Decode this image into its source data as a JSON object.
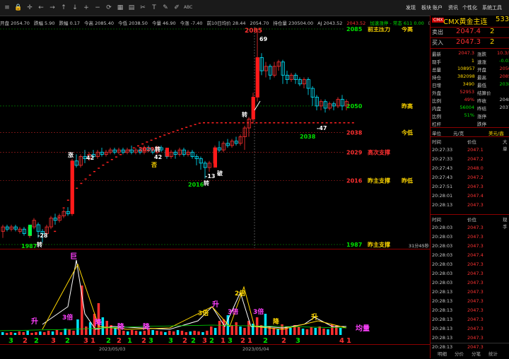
{
  "toolbar": {
    "icons": [
      "menu-icon",
      "lock-icon",
      "crosshair-icon",
      "back-icon",
      "forward-icon",
      "up-icon",
      "down-icon",
      "zoom-in-icon",
      "zoom-out-icon",
      "refresh-icon",
      "chart-icon",
      "grid-icon",
      "cut-icon",
      "text-icon",
      "draw-icon",
      "pen-icon",
      "abc-icon"
    ],
    "abc_label": "ABC",
    "menu": [
      "发现",
      "板块",
      "账户",
      "资讯",
      "个性化",
      "系统工具"
    ]
  },
  "infostrip": [
    {
      "label": "开盘 2054.70",
      "color": "#c8c8c8"
    },
    {
      "label": "跌幅 5.90",
      "color": "#c8c8c8"
    },
    {
      "label": "跌幅 0.17",
      "color": "#c8c8c8"
    },
    {
      "label": "今高 2085.40",
      "color": "#c8c8c8"
    },
    {
      "label": "今低 2038.50",
      "color": "#c8c8c8"
    },
    {
      "label": "今量 46.90",
      "color": "#c8c8c8"
    },
    {
      "label": "今涨 -7.40",
      "color": "#c8c8c8"
    },
    {
      "label": "前10日均价 28.44",
      "color": "#c8c8c8"
    },
    {
      "label": "2054.70",
      "color": "#c8c8c8"
    },
    {
      "label": "持仓量 230504.00",
      "color": "#c8c8c8"
    },
    {
      "label": "AJ 2043.52",
      "color": "#c8c8c8"
    },
    {
      "label": "2043.52",
      "color": "#ff3030"
    },
    {
      "label": "加速涨停 - 常态 611 0.00",
      "color": "#00e000"
    },
    {
      "label": "Delay",
      "color": "#888"
    }
  ],
  "levels": [
    {
      "value": "2085",
      "text": "前主压力",
      "text2": "今高",
      "color": "#00e000",
      "textcolor": "#ffd700"
    },
    {
      "value": "2050",
      "text": "",
      "text2": "昨高",
      "color": "#00e000",
      "textcolor": "#ffd700"
    },
    {
      "value": "2038",
      "text": "",
      "text2": "今低",
      "color": "#ff3030",
      "textcolor": "#ffd700"
    },
    {
      "value": "2029",
      "text": "高次支撑",
      "text2": "",
      "color": "#ff3030",
      "textcolor": "#ff3030"
    },
    {
      "value": "2016",
      "text": "昨主支撑",
      "text2": "昨低",
      "color": "#ff3030",
      "textcolor": "#ffd700"
    },
    {
      "value": "1987",
      "text": "昨主支撑",
      "text2": "",
      "color": "#00e000",
      "textcolor": "#ffd700"
    }
  ],
  "chart_labels": {
    "peak": "2085",
    "peak_num": "69",
    "n42": "42",
    "n2029": "2029",
    "zhuan": "转",
    "n42b": "42",
    "fou": "否",
    "n13": "-13",
    "po": "破",
    "n2016": "2016",
    "n2016z": "转",
    "n28": "-28",
    "n1987": "1987",
    "n1987z": "转",
    "zhang": "涨",
    "zhuan2": "转",
    "n47": "-47",
    "n2038": "2038",
    "n2038b": "转",
    "vol_readout": "31分45秒"
  },
  "volume_labels": {
    "ju": "巨",
    "sheng1": "升",
    "sheng2": "升",
    "sheng3": "升",
    "bei3": "3倍",
    "bei3b": "3倍",
    "bei3c": "3倍",
    "bei2": "2倍",
    "bei3d": "3倍",
    "jiang1": "降",
    "jiang2": "降",
    "jiang3": "降",
    "jiang4": "降",
    "juliang": "均量",
    "digits": [
      {
        "d": "3",
        "c": "#00e000"
      },
      {
        "d": "2",
        "c": "#ff3030"
      },
      {
        "d": "2",
        "c": "#00e000"
      },
      {
        "d": "3",
        "c": "#ff3030"
      },
      {
        "d": "2",
        "c": "#00e000"
      },
      {
        "d": "3",
        "c": "#ff3030"
      },
      {
        "d": "1",
        "c": "#ff3030"
      },
      {
        "d": "2",
        "c": "#00e000"
      },
      {
        "d": "2",
        "c": "#ff3030"
      },
      {
        "d": "1",
        "c": "#00e000"
      },
      {
        "d": "2",
        "c": "#ff3030"
      },
      {
        "d": "3",
        "c": "#00e000"
      },
      {
        "d": "3",
        "c": "#00e000"
      },
      {
        "d": "2",
        "c": "#ff3030"
      },
      {
        "d": "2",
        "c": "#00e000"
      },
      {
        "d": "3",
        "c": "#ff3030"
      },
      {
        "d": "2",
        "c": "#00e000"
      },
      {
        "d": "1",
        "c": "#ff3030"
      },
      {
        "d": "3",
        "c": "#00e000"
      },
      {
        "d": "2",
        "c": "#ff3030"
      },
      {
        "d": "1",
        "c": "#ff3030"
      },
      {
        "d": "2",
        "c": "#00e000"
      },
      {
        "d": "2",
        "c": "#ff3030"
      },
      {
        "d": "3",
        "c": "#00e000"
      },
      {
        "d": "4",
        "c": "#ff3030"
      },
      {
        "d": "1",
        "c": "#ff3030"
      }
    ]
  },
  "dates": [
    "2023/05/03",
    "2023/05/04"
  ],
  "rpanel": {
    "badge": "CMX",
    "title": "CMX黄金主连",
    "code": "533",
    "sell_label": "卖出",
    "sell_price": "2047.4",
    "sell_qty": "2",
    "buy_label": "买入",
    "buy_price": "2047.3",
    "buy_qty": "2",
    "stats": [
      {
        "l": "最新",
        "v": "2047.3",
        "vc": "#ff3030",
        "l2": "涨跌",
        "v2": "10.3/0.5",
        "v2c": "#ff3030"
      },
      {
        "l": "现手",
        "v": "1",
        "vc": "#ffd700",
        "l2": "速涨",
        "v2": "-0.03",
        "v2c": "#00e000"
      },
      {
        "l": "总量",
        "v": "108957",
        "vc": "#ffd700",
        "l2": "开盘",
        "v2": "2056",
        "v2c": "#ff3030"
      },
      {
        "l": "持仓",
        "v": "382098",
        "vc": "#ffd700",
        "l2": "最高",
        "v2": "2085",
        "v2c": "#ff3030"
      },
      {
        "l": "日增",
        "v": "3490",
        "vc": "#ffd700",
        "l2": "最低",
        "v2": "2038",
        "v2c": "#00e000"
      },
      {
        "l": "外盘",
        "v": "52953",
        "vc": "#ff3030",
        "l2": "结算价",
        "v2": "",
        "v2c": "#c8c8c8"
      },
      {
        "l": "比例",
        "v": "49%",
        "vc": "#ff3030",
        "l2": "昨收",
        "v2": "2048",
        "v2c": "#c8c8c8"
      },
      {
        "l": "内盘",
        "v": "56004",
        "vc": "#00e000",
        "l2": "昨结",
        "v2": "2037",
        "v2c": "#c8c8c8"
      },
      {
        "l": "比例",
        "v": "51%",
        "vc": "#00e000",
        "l2": "涨停",
        "v2": "",
        "v2c": "#c8c8c8"
      },
      {
        "l": "杠杆",
        "v": "",
        "vc": "#c8c8c8",
        "l2": "跌停",
        "v2": "",
        "v2c": "#c8c8c8"
      }
    ],
    "unit_label": "单位",
    "unit_value": "元/克",
    "unit_value2": "美元/盎",
    "tick_headers": [
      "时间",
      "价位",
      "大单"
    ],
    "ticks_a": [
      {
        "t": "20:27:33",
        "p": "2047.1"
      },
      {
        "t": "20:27:33",
        "p": "2047.2"
      },
      {
        "t": "20:27:43",
        "p": "2048.0"
      },
      {
        "t": "20:27:43",
        "p": "2047.2"
      },
      {
        "t": "20:27:51",
        "p": "2047.3"
      },
      {
        "t": "20:28:01",
        "p": "2047.4"
      },
      {
        "t": "20:28:13",
        "p": "2047.3"
      }
    ],
    "tick_headers_b": [
      "时间",
      "价位",
      "现手"
    ],
    "ticks_b": [
      {
        "t": "20:28:03",
        "p": "2047.3"
      },
      {
        "t": "20:28:03",
        "p": "2047.3"
      },
      {
        "t": "20:28:03",
        "p": "2047.3"
      },
      {
        "t": "20:28:03",
        "p": "2047.4"
      },
      {
        "t": "20:28:03",
        "p": "2047.3"
      },
      {
        "t": "20:28:03",
        "p": "2047.3"
      },
      {
        "t": "20:28:03",
        "p": "2047.3"
      },
      {
        "t": "20:28:13",
        "p": "2047.3"
      },
      {
        "t": "20:28:13",
        "p": "2047.3"
      },
      {
        "t": "20:28:13",
        "p": "2047.3"
      },
      {
        "t": "20:28:13",
        "p": "2047.3"
      },
      {
        "t": "20:28:13",
        "p": "2047.3"
      },
      {
        "t": "20:28:13",
        "p": "2047.3"
      },
      {
        "t": "20:28:13",
        "p": "2047.3"
      }
    ],
    "bottom_tabs": [
      "明细",
      "分价",
      "分笔",
      "统计"
    ],
    "brand": "同花顺"
  }
}
